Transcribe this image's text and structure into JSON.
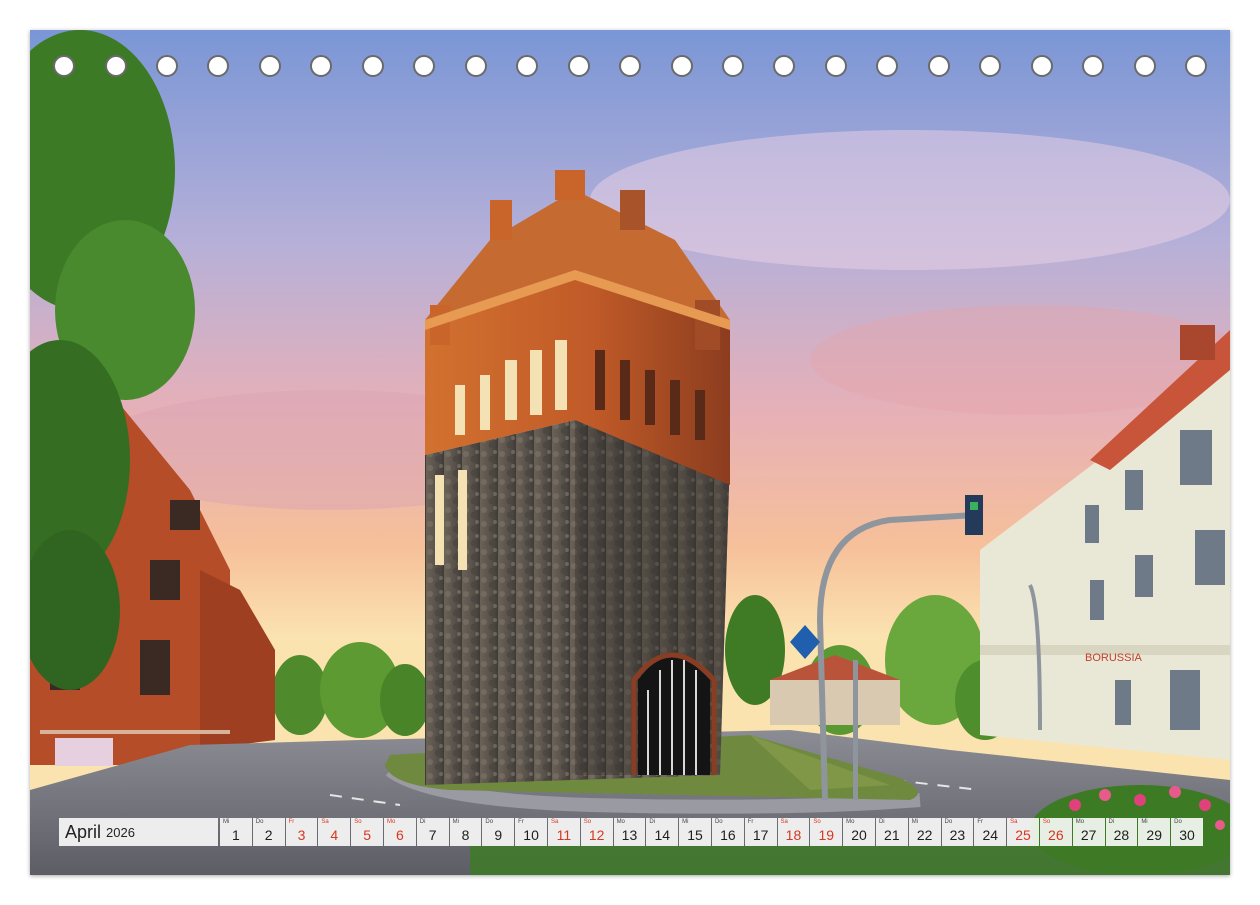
{
  "calendar": {
    "month": "April",
    "year": "2026",
    "days": [
      {
        "num": "1",
        "wd": "Mi",
        "type": "weekday"
      },
      {
        "num": "2",
        "wd": "Do",
        "type": "weekday"
      },
      {
        "num": "3",
        "wd": "Fr",
        "type": "holiday"
      },
      {
        "num": "4",
        "wd": "Sa",
        "type": "weekend"
      },
      {
        "num": "5",
        "wd": "So",
        "type": "weekend"
      },
      {
        "num": "6",
        "wd": "Mo",
        "type": "holiday"
      },
      {
        "num": "7",
        "wd": "Di",
        "type": "weekday"
      },
      {
        "num": "8",
        "wd": "Mi",
        "type": "weekday"
      },
      {
        "num": "9",
        "wd": "Do",
        "type": "weekday"
      },
      {
        "num": "10",
        "wd": "Fr",
        "type": "weekday"
      },
      {
        "num": "11",
        "wd": "Sa",
        "type": "weekend"
      },
      {
        "num": "12",
        "wd": "So",
        "type": "weekend"
      },
      {
        "num": "13",
        "wd": "Mo",
        "type": "weekday"
      },
      {
        "num": "14",
        "wd": "Di",
        "type": "weekday"
      },
      {
        "num": "15",
        "wd": "Mi",
        "type": "weekday"
      },
      {
        "num": "16",
        "wd": "Do",
        "type": "weekday"
      },
      {
        "num": "17",
        "wd": "Fr",
        "type": "weekday"
      },
      {
        "num": "18",
        "wd": "Sa",
        "type": "weekend"
      },
      {
        "num": "19",
        "wd": "So",
        "type": "weekend"
      },
      {
        "num": "20",
        "wd": "Mo",
        "type": "weekday"
      },
      {
        "num": "21",
        "wd": "Di",
        "type": "weekday"
      },
      {
        "num": "22",
        "wd": "Mi",
        "type": "weekday"
      },
      {
        "num": "23",
        "wd": "Do",
        "type": "weekday"
      },
      {
        "num": "24",
        "wd": "Fr",
        "type": "weekday"
      },
      {
        "num": "25",
        "wd": "Sa",
        "type": "weekend"
      },
      {
        "num": "26",
        "wd": "So",
        "type": "weekend"
      },
      {
        "num": "27",
        "wd": "Mo",
        "type": "weekday"
      },
      {
        "num": "28",
        "wd": "Di",
        "type": "weekday"
      },
      {
        "num": "29",
        "wd": "Mi",
        "type": "weekday"
      },
      {
        "num": "30",
        "wd": "Do",
        "type": "weekday"
      }
    ]
  },
  "photo": {
    "building_sign": "BORUSSIA"
  },
  "binding": {
    "ring_count": 23
  },
  "colors": {
    "weekend_red": "#d8361f",
    "brick": "#b24a25",
    "stone": "#5b5650"
  }
}
